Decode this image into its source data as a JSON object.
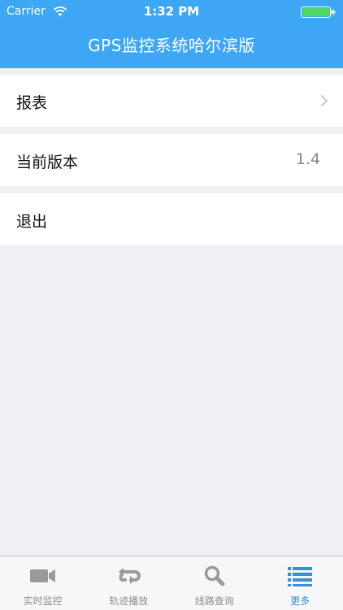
{
  "status_bar": {
    "carrier": "Carrier",
    "time": "1:32 PM"
  },
  "nav": {
    "title": "GPS监控系统哈尔滨版"
  },
  "menu": {
    "reports_label": "报表",
    "version_label": "当前版本",
    "version_value": "1.4",
    "logout_label": "退出"
  },
  "tab_bar": {
    "tabs": [
      {
        "label": "实时监控",
        "icon": "video-camera-icon"
      },
      {
        "label": "轨迹播放",
        "icon": "replay-icon"
      },
      {
        "label": "线路查询",
        "icon": "search-icon"
      },
      {
        "label": "更多",
        "icon": "list-icon"
      }
    ],
    "active_index": 3
  },
  "colors": {
    "header": "#3da6f5",
    "active_tab": "#3a8fd8",
    "inactive_tab": "#8e8e8e",
    "background": "#efeff4"
  }
}
